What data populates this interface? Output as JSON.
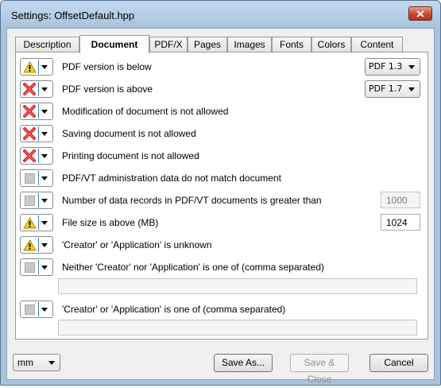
{
  "window": {
    "title": "Settings:  OffsetDefault.hpp"
  },
  "tabs": [
    {
      "label": "Description"
    },
    {
      "label": "Document"
    },
    {
      "label": "PDF/X"
    },
    {
      "label": "Pages"
    },
    {
      "label": "Images"
    },
    {
      "label": "Fonts"
    },
    {
      "label": "Colors"
    },
    {
      "label": "Content"
    }
  ],
  "active_tab": "Document",
  "rules": [
    {
      "icon": "warning-icon",
      "label": "PDF version is below",
      "select_value": "PDF 1.3"
    },
    {
      "icon": "error-icon",
      "label": "PDF version is above",
      "select_value": "PDF 1.7"
    },
    {
      "icon": "error-icon",
      "label": "Modification of document is not allowed"
    },
    {
      "icon": "error-icon",
      "label": "Saving document is not allowed"
    },
    {
      "icon": "error-icon",
      "label": "Printing document is not allowed"
    },
    {
      "icon": "off-icon",
      "label": "PDF/VT administration data do not match document"
    },
    {
      "icon": "off-icon",
      "label": "Number of data records in PDF/VT documents is greater than",
      "field_value": "1000"
    },
    {
      "icon": "warning-icon",
      "label": "File size is above (MB)",
      "field_value": "1024"
    },
    {
      "icon": "warning-icon",
      "label": "'Creator' or 'Application' is unknown"
    },
    {
      "icon": "off-icon",
      "label": "Neither 'Creator' nor 'Application' is one of (comma separated)",
      "text_value": ""
    },
    {
      "icon": "off-icon",
      "label": "'Creator' or 'Application' is one of (comma separated)",
      "text_value": ""
    }
  ],
  "footer": {
    "unit": "mm",
    "save_as_label": "Save As...",
    "save_close_label": "Save & Close",
    "cancel_label": "Cancel"
  },
  "colors": {
    "warning": "#f5cf1d",
    "error": "#d8262a",
    "titlebar": "#a9c3de"
  }
}
